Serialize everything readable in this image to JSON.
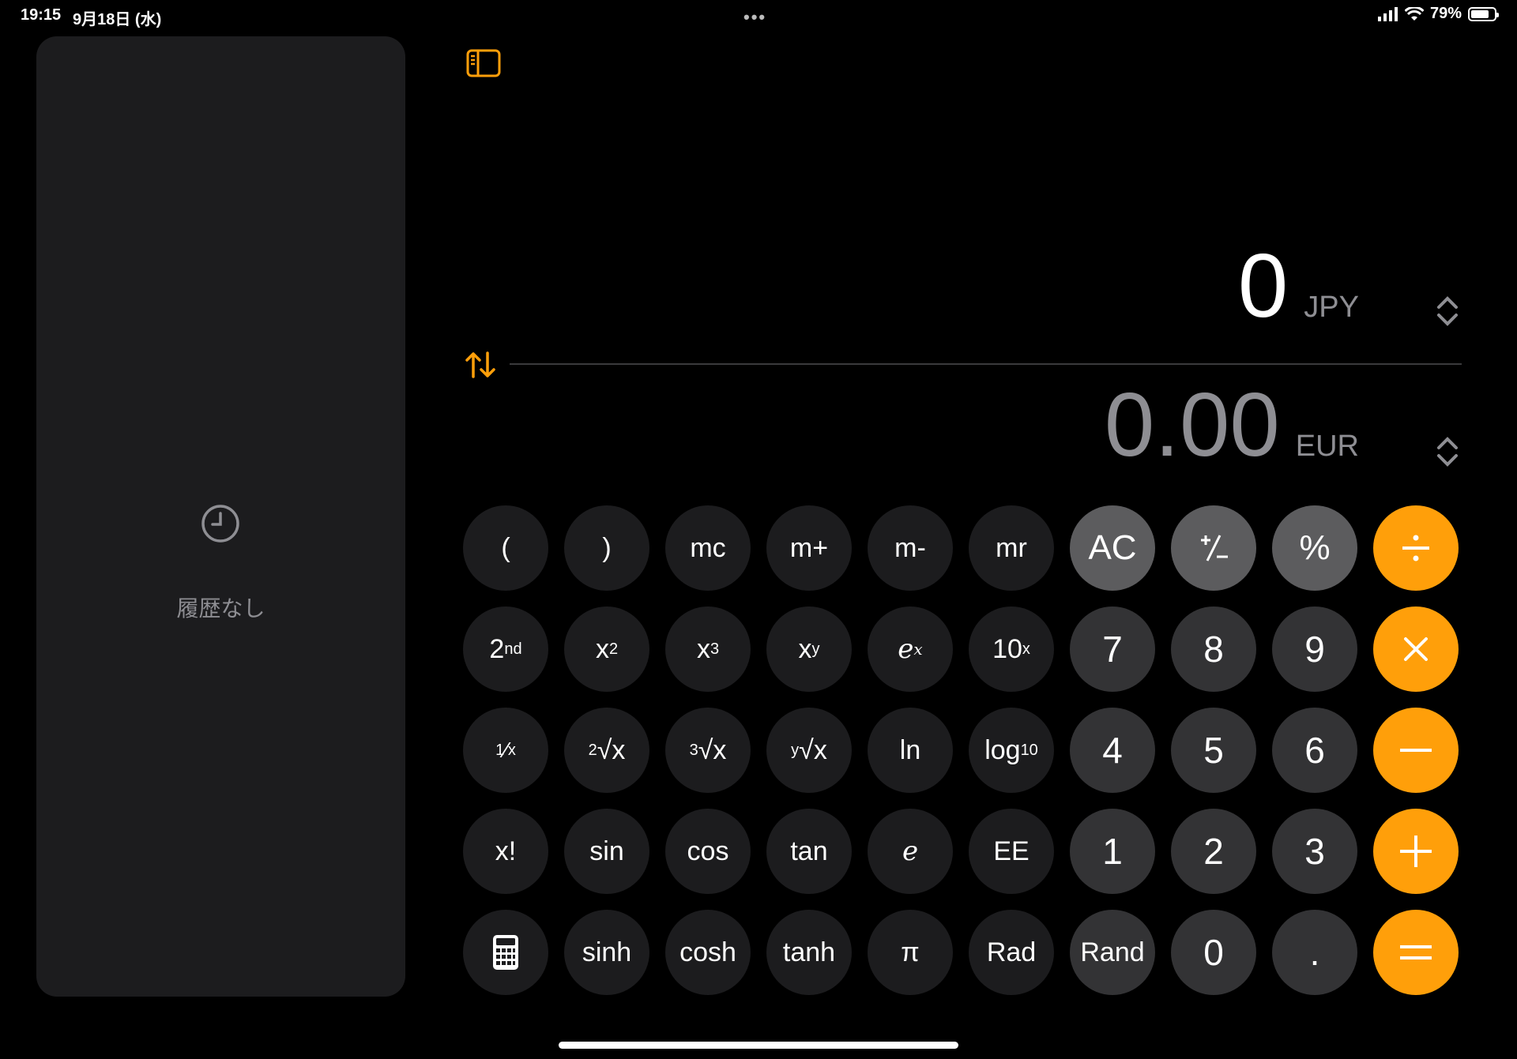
{
  "status": {
    "time": "19:15",
    "date": "9月18日 (水)",
    "battery": "79%",
    "battery_level": 0.79
  },
  "history": {
    "empty_label": "履歴なし"
  },
  "display": {
    "top_value": "0",
    "top_currency": "JPY",
    "bottom_value": "0.00",
    "bottom_currency": "EUR"
  },
  "keys": {
    "lparen": "(",
    "rparen": ")",
    "mc": "mc",
    "mplus": "m+",
    "mminus": "m-",
    "mr": "mr",
    "ac": "AC",
    "percent": "%",
    "two_base": "2",
    "two_sup": "nd",
    "x": "x",
    "sq": "2",
    "cube": "3",
    "y": "y",
    "e": "e",
    "ten": "10",
    "ln": "ln",
    "log": "log",
    "log_sub": "10",
    "fact": "x!",
    "sin": "sin",
    "cos": "cos",
    "tan": "tan",
    "e_const": "e",
    "ee": "EE",
    "sinh": "sinh",
    "cosh": "cosh",
    "tanh": "tanh",
    "pi": "π",
    "rad": "Rad",
    "rand": "Rand",
    "n0": "0",
    "n1": "1",
    "n2": "2",
    "n3": "3",
    "n4": "4",
    "n5": "5",
    "n6": "6",
    "n7": "7",
    "n8": "8",
    "n9": "9",
    "dot": ".",
    "root_x": "x",
    "root2": "2",
    "root3": "3",
    "rooty": "y",
    "inv_one": "1",
    "inv_x": "x"
  },
  "colors": {
    "accent": "#ff9f0a",
    "panel": "#1c1c1e",
    "num_key": "#333335",
    "fn_key": "#5c5c5e"
  }
}
